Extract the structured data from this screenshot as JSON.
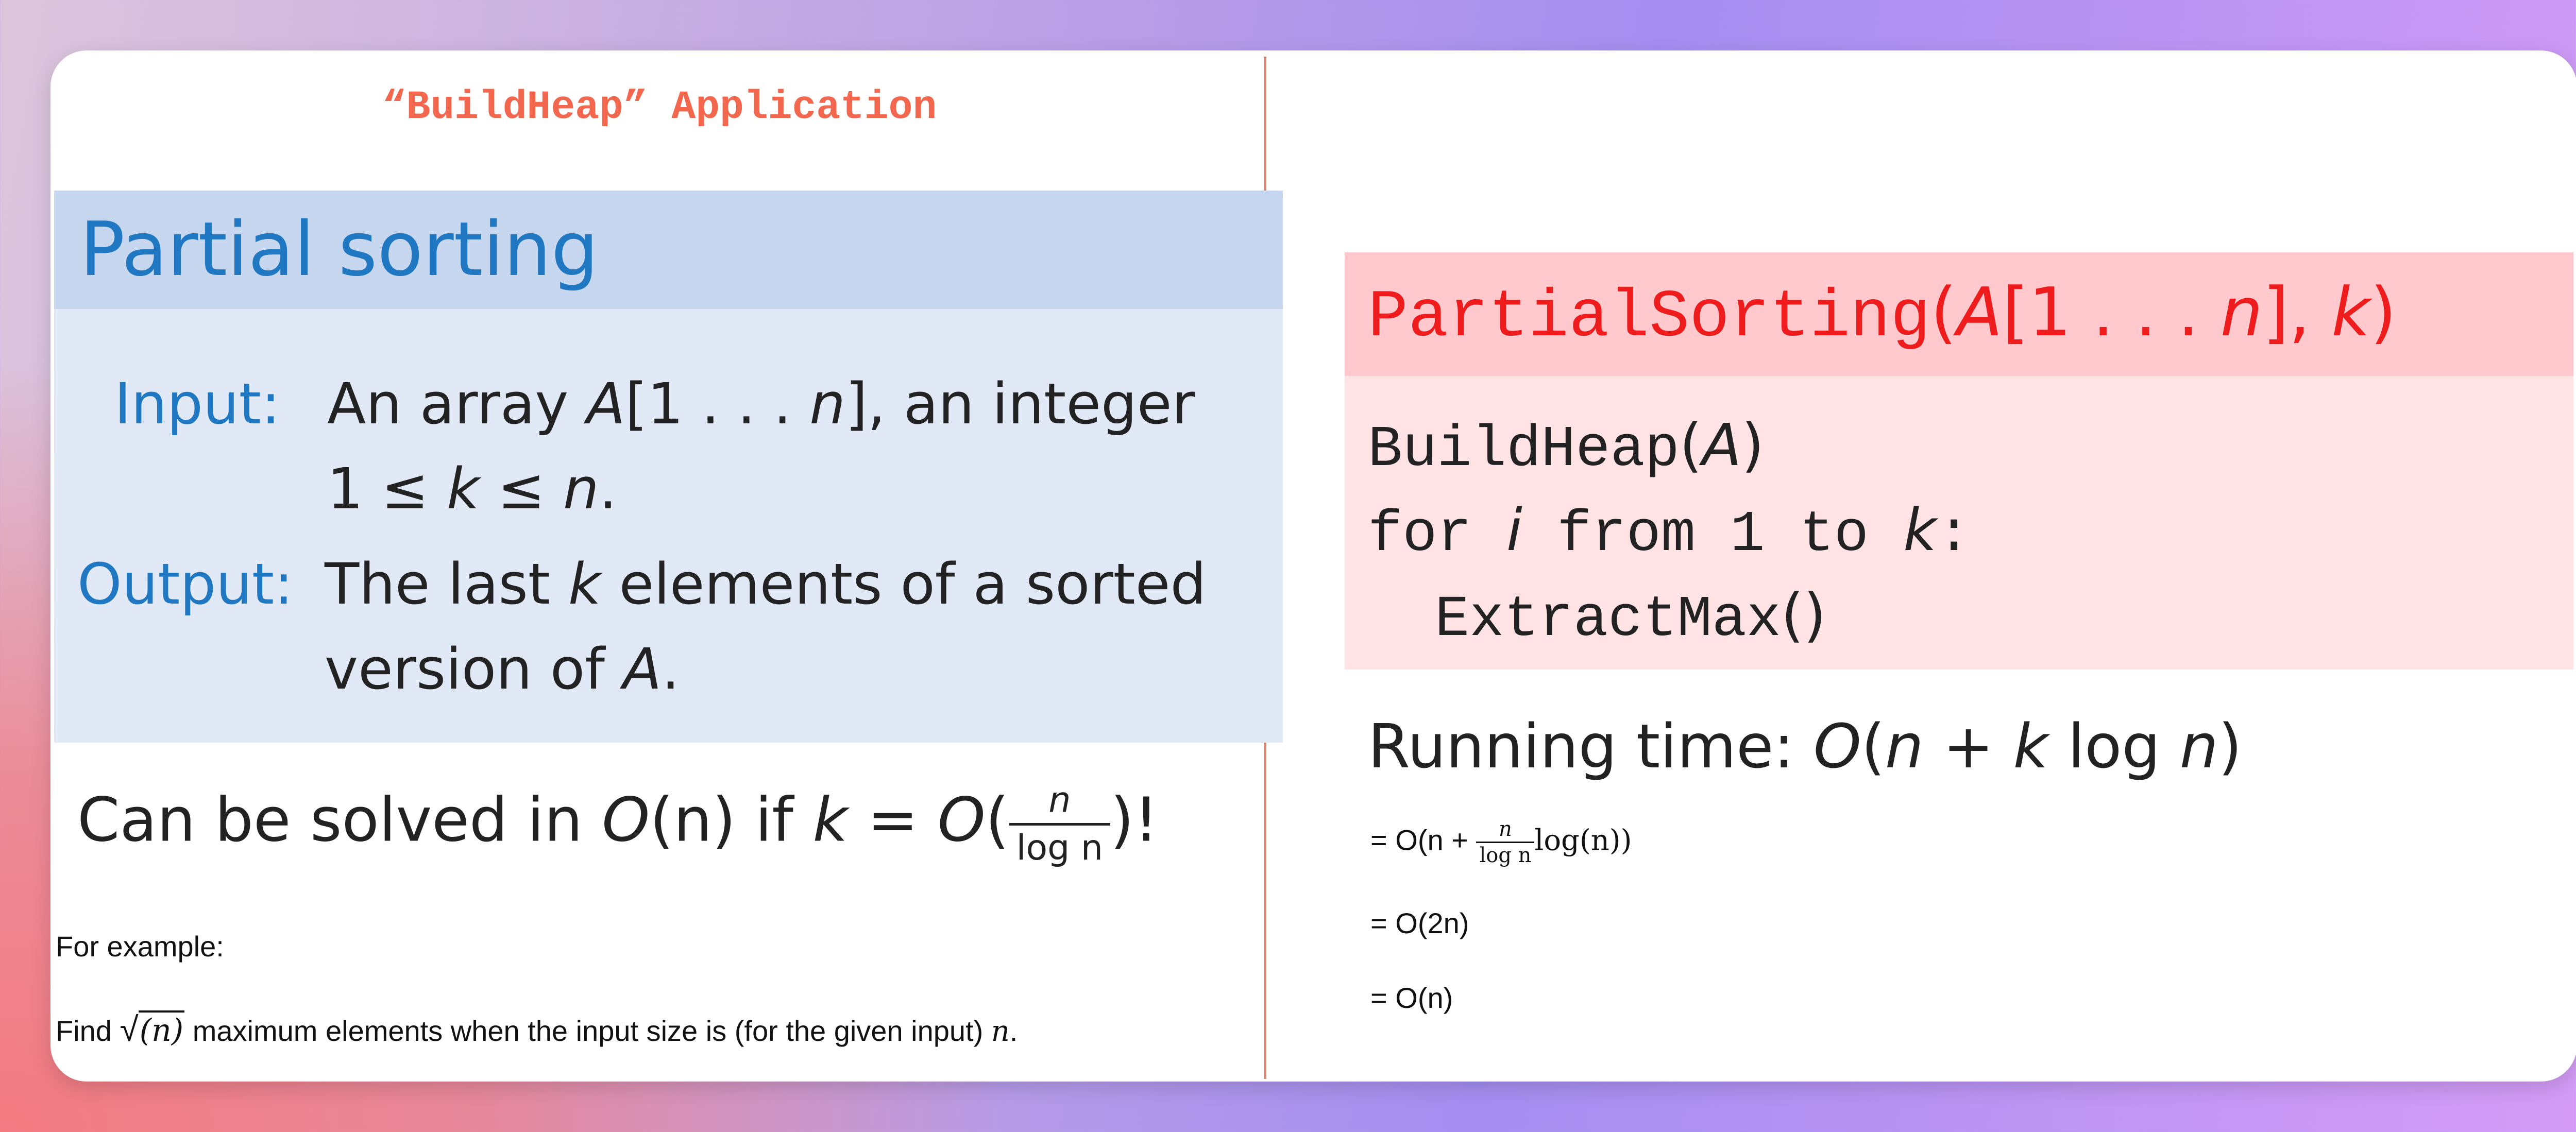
{
  "app_title": "“BuildHeap” Application",
  "left": {
    "block_title": "Partial sorting",
    "input_label": "Input:",
    "input_line1": {
      "pre": "An array ",
      "var": "A",
      "rest": "[1 . . . ",
      "n": "n",
      "post": "], an integer"
    },
    "input_line2": {
      "one": "1 ≤ ",
      "k": "k",
      "mid": " ≤ ",
      "n": "n",
      "end": "."
    },
    "output_label": "Output:",
    "output_line1": {
      "pre": "The last ",
      "k": "k",
      "post": " elements of a sorted"
    },
    "output_line2": {
      "pre": "version of ",
      "var": "A",
      "end": "."
    },
    "solve": {
      "pre": "Can be solved in ",
      "O1": "O",
      "n1": "(n)",
      "mid": " if ",
      "k": "k",
      "eq": " = ",
      "O2": "O",
      "open": "(",
      "frac_num": "n",
      "frac_den": "log n",
      "close": ")!"
    },
    "example_label": "For example:",
    "find": {
      "pre": "Find ",
      "sqrt": "√",
      "arg": "(n)",
      "post": " maximum elements when the input size is (for the given input) ",
      "n": "n",
      "end": "."
    }
  },
  "right": {
    "algo_title": {
      "name": "PartialSorting",
      "open": "(",
      "A": "A",
      "range": "[1 . . . ",
      "n": "n",
      "sep": "], ",
      "k": "k",
      "close": ")"
    },
    "line1": {
      "fn": "BuildHeap",
      "open": "(",
      "A": "A",
      "close": ")"
    },
    "line2": {
      "for": "for ",
      "i": "i",
      "from": " from 1 to ",
      "k": "k",
      "colon": ":"
    },
    "line3": {
      "fn": "ExtractMax",
      "parens": "()"
    },
    "running": {
      "label": "Running time:  ",
      "O": "O",
      "open": "(",
      "n": "n",
      "plus": " + ",
      "k": "k",
      "log": " log ",
      "n2": "n",
      "close": ")"
    },
    "eq1": {
      "pre": "= O(n + ",
      "frac_num": "n",
      "frac_den": "log n",
      "post": "log(n))"
    },
    "eq2": "= O(2n)",
    "eq3": "= O(n)"
  }
}
